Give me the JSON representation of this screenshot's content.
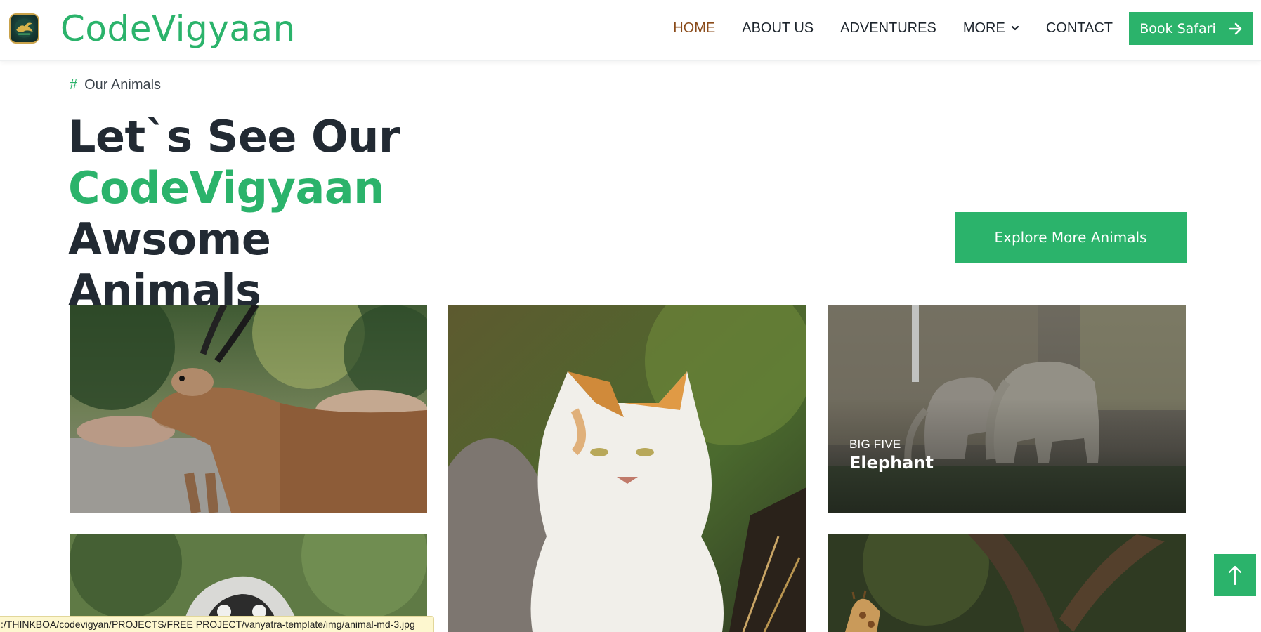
{
  "header": {
    "brand": "CodeVigyaan",
    "logo_icon": "safari-logo-icon",
    "nav": [
      {
        "label": "HOME",
        "active": true
      },
      {
        "label": "ABOUT US",
        "active": false
      },
      {
        "label": "ADVENTURES",
        "active": false
      },
      {
        "label": "MORE",
        "active": false,
        "has_dropdown": true
      },
      {
        "label": "CONTACT",
        "active": false
      }
    ],
    "cta_label": "Book Safari",
    "cta_icon": "arrow-right-icon"
  },
  "section": {
    "eyebrow_symbol": "#",
    "eyebrow": "Our Animals",
    "headline_part1": "Let`s See Our",
    "headline_accent": "CodeVigyaan",
    "headline_part2": "Awsome",
    "headline_part3": "Animals",
    "explore_label": "Explore More Animals"
  },
  "gallery": [
    {
      "animal": "antelope",
      "category": "",
      "title": ""
    },
    {
      "animal": "cat",
      "category": "",
      "title": ""
    },
    {
      "animal": "elephant",
      "category": "BIG FIVE",
      "title": "Elephant"
    },
    {
      "animal": "lemur",
      "category": "",
      "title": ""
    },
    {
      "animal": "giraffe",
      "category": "",
      "title": ""
    }
  ],
  "back_to_top_icon": "arrow-up-icon",
  "status_bar": {
    "url": ":/THINKBOA/codevigyan/PROJECTS/FREE PROJECT/vanyatra-template/img/animal-md-3.jpg"
  },
  "colors": {
    "brand_green": "#2bb36b",
    "active_nav": "#8a4b1a",
    "text_dark": "#222a33",
    "status_bg": "#fdf7cf"
  }
}
